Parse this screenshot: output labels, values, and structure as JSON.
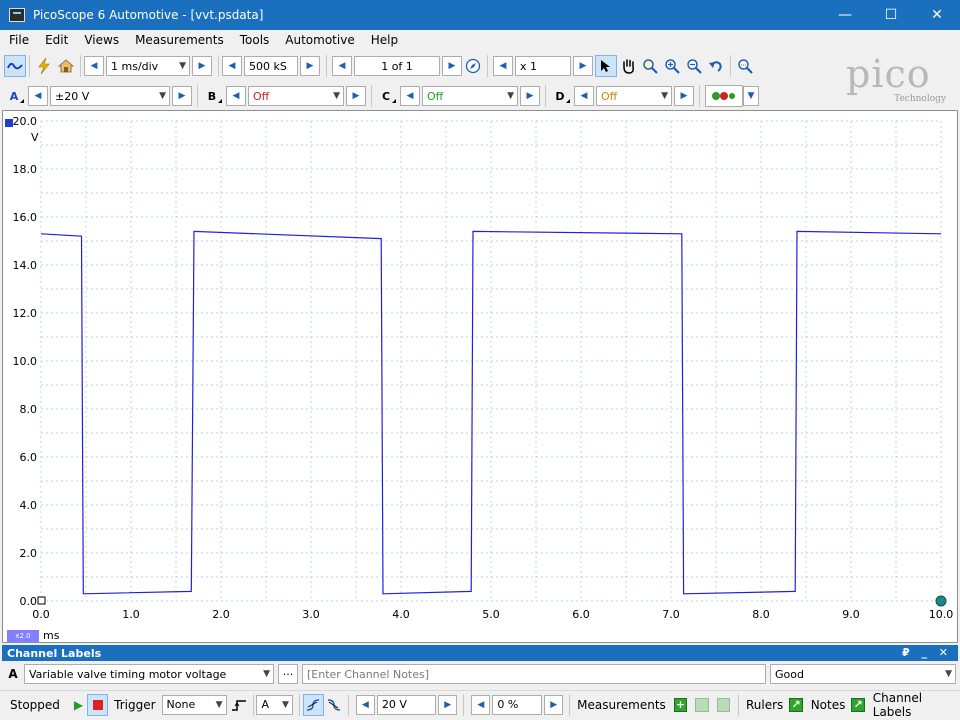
{
  "window": {
    "title": "PicoScope 6 Automotive - [vvt.psdata]",
    "minimize": "—",
    "maximize": "☐",
    "close": "✕"
  },
  "menu": {
    "items": [
      "File",
      "Edit",
      "Views",
      "Measurements",
      "Tools",
      "Automotive",
      "Help"
    ]
  },
  "toolbar": {
    "timebase": "1 ms/div",
    "samples": "500 kS",
    "buffer": "1 of 1",
    "zoom": "x 1"
  },
  "channels": {
    "a": {
      "letter": "A",
      "range": "±20 V"
    },
    "b": {
      "letter": "B",
      "range": "Off",
      "color": "#d02020"
    },
    "c": {
      "letter": "C",
      "range": "Off",
      "color": "#20a020"
    },
    "d": {
      "letter": "D",
      "range": "Off",
      "color": "#c08a00"
    }
  },
  "logo": {
    "word": "pico",
    "sub": "Technology"
  },
  "scope": {
    "trace_color": "#2020e0",
    "x_unit": "ms",
    "x_zoom_badge": "x2.0",
    "y_unit": "V",
    "y_ticks": [
      "0.0",
      "2.0",
      "4.0",
      "6.0",
      "8.0",
      "10.0",
      "12.0",
      "14.0",
      "16.0",
      "18.0",
      "20.0"
    ],
    "x_ticks": [
      "0.0",
      "1.0",
      "2.0",
      "3.0",
      "4.0",
      "5.0",
      "6.0",
      "7.0",
      "8.0",
      "9.0",
      "10.0"
    ]
  },
  "chart_data": {
    "type": "line",
    "xlabel": "ms",
    "ylabel": "V",
    "xlim": [
      0,
      10
    ],
    "ylim": [
      0,
      20
    ],
    "grid": true,
    "series": [
      {
        "x": [
          0.0,
          0.45,
          0.47,
          1.67,
          1.7,
          3.78,
          3.8,
          4.78,
          4.8,
          7.12,
          7.14,
          8.38,
          8.4,
          10.0
        ],
        "y": [
          15.3,
          15.2,
          0.3,
          0.4,
          15.4,
          15.1,
          0.3,
          0.4,
          15.4,
          15.3,
          0.3,
          0.4,
          15.4,
          15.3
        ]
      }
    ]
  },
  "panel": {
    "title": "Channel Labels",
    "pin_controls": "₽ _ ✕",
    "channel_letter": "A",
    "label_value": "Variable valve timing motor voltage",
    "ellipsis": "···",
    "notes_placeholder": "[Enter Channel Notes]",
    "status_value": "Good"
  },
  "statusbar": {
    "state": "Stopped",
    "trigger_label": "Trigger",
    "trigger_mode": "None",
    "trigger_channel": "A",
    "trigger_level": "20 V",
    "pre_trigger": "0 %",
    "measurements_label": "Measurements",
    "rulers_label": "Rulers",
    "notes_label": "Notes",
    "channel_labels_label": "Channel Labels"
  }
}
